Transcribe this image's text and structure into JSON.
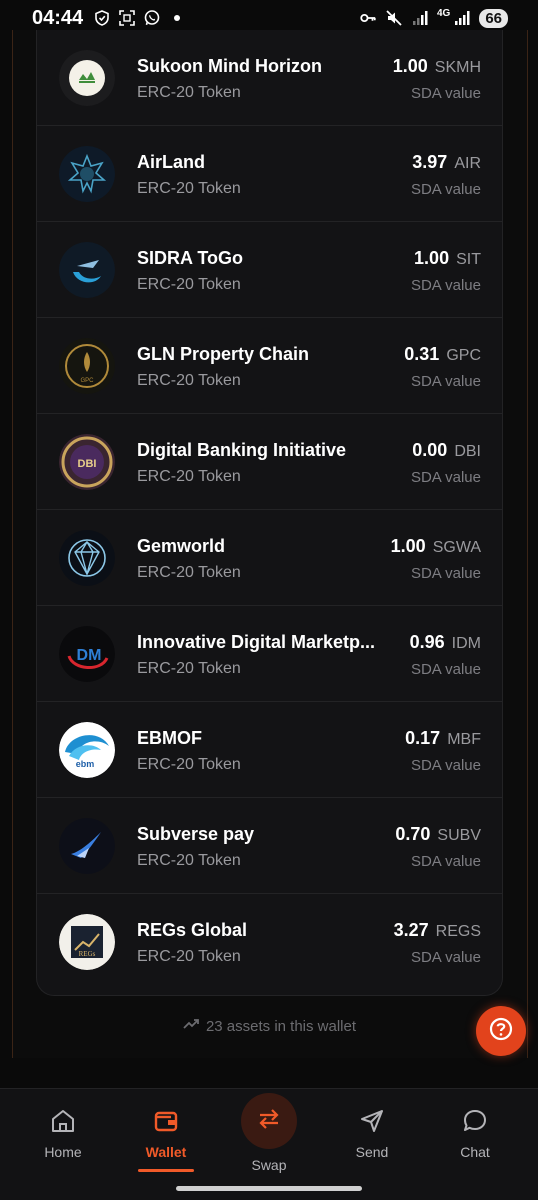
{
  "status_bar": {
    "time": "04:44",
    "network": "4G",
    "battery": "66",
    "icons": [
      "shield-icon",
      "screenshot-icon",
      "whatsapp-icon",
      "dot-icon",
      "key-icon",
      "mute-icon",
      "signal-icon",
      "signal-icon"
    ]
  },
  "tokens": [
    {
      "name": "Sukoon Mind Horizon",
      "type": "ERC-20 Token",
      "value": "1.00",
      "symbol": "SKMH",
      "sub": "SDA value",
      "logo": "sukoon-logo-icon"
    },
    {
      "name": "AirLand",
      "type": "ERC-20 Token",
      "value": "3.97",
      "symbol": "AIR",
      "sub": "SDA value",
      "logo": "airland-logo-icon"
    },
    {
      "name": "SIDRA ToGo",
      "type": "ERC-20 Token",
      "value": "1.00",
      "symbol": "SIT",
      "sub": "SDA value",
      "logo": "sidra-togo-logo-icon"
    },
    {
      "name": "GLN Property Chain",
      "type": "ERC-20 Token",
      "value": "0.31",
      "symbol": "GPC",
      "sub": "SDA value",
      "logo": "gpc-logo-icon"
    },
    {
      "name": "Digital Banking Initiative",
      "type": "ERC-20 Token",
      "value": "0.00",
      "symbol": "DBI",
      "sub": "SDA value",
      "logo": "dbi-logo-icon"
    },
    {
      "name": "Gemworld",
      "type": "ERC-20 Token",
      "value": "1.00",
      "symbol": "SGWA",
      "sub": "SDA value",
      "logo": "gemworld-logo-icon"
    },
    {
      "name": "Innovative Digital Marketp...",
      "type": "ERC-20 Token",
      "value": "0.96",
      "symbol": "IDM",
      "sub": "SDA value",
      "logo": "idm-logo-icon"
    },
    {
      "name": "EBMOF",
      "type": "ERC-20 Token",
      "value": "0.17",
      "symbol": "MBF",
      "sub": "SDA value",
      "logo": "ebmof-logo-icon"
    },
    {
      "name": "Subverse pay",
      "type": "ERC-20 Token",
      "value": "0.70",
      "symbol": "SUBV",
      "sub": "SDA value",
      "logo": "subverse-logo-icon"
    },
    {
      "name": "REGs Global",
      "type": "ERC-20 Token",
      "value": "3.27",
      "symbol": "REGS",
      "sub": "SDA value",
      "logo": "regs-logo-icon"
    }
  ],
  "logo_text": {
    "gpc": "GPC",
    "dbi": "DBI",
    "idm": "DM",
    "ebmof": "ebm",
    "regs": "REGs"
  },
  "footer": {
    "assets_text": "23 assets in this wallet",
    "assets_icon": "trend-up-icon"
  },
  "nav": {
    "items": [
      {
        "label": "Home",
        "icon": "home-icon",
        "active": false
      },
      {
        "label": "Wallet",
        "icon": "wallet-icon",
        "active": true
      },
      {
        "label": "Swap",
        "icon": "swap-icon",
        "active": false
      },
      {
        "label": "Send",
        "icon": "send-icon",
        "active": false
      },
      {
        "label": "Chat",
        "icon": "chat-icon",
        "active": false
      }
    ]
  },
  "colors": {
    "accent": "#f15a29",
    "help_button": "#e2431c",
    "background": "#0a0a0a",
    "card": "#131315"
  }
}
